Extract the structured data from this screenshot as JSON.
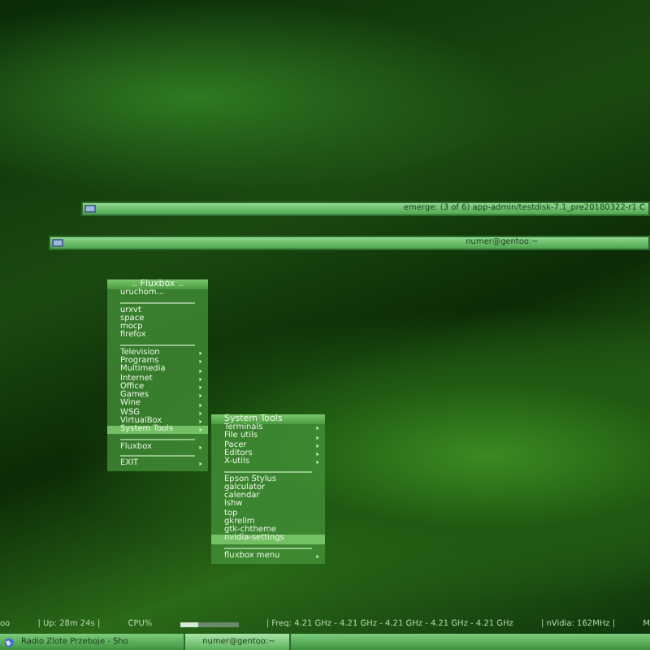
{
  "windows": [
    {
      "title": "emerge: (3 of 6) app-admin/testdisk-7.1_pre20180322-r1 C"
    },
    {
      "title": "numer@gentoo:~"
    }
  ],
  "root_menu": {
    "title": ".. Fluxbox ..",
    "items": [
      {
        "kind": "item",
        "label": "uruchom...",
        "selected": false
      },
      {
        "kind": "separator"
      },
      {
        "kind": "item",
        "label": "urxvt",
        "selected": false
      },
      {
        "kind": "item",
        "label": "space",
        "selected": false
      },
      {
        "kind": "item",
        "label": "mocp",
        "selected": false
      },
      {
        "kind": "item",
        "label": "firefox",
        "selected": false
      },
      {
        "kind": "separator"
      },
      {
        "kind": "submenu",
        "label": "Television",
        "selected": false
      },
      {
        "kind": "submenu",
        "label": "Programs",
        "selected": false
      },
      {
        "kind": "submenu",
        "label": "Multimedia",
        "selected": false
      },
      {
        "kind": "submenu",
        "label": "Internet",
        "selected": false
      },
      {
        "kind": "submenu",
        "label": "Office",
        "selected": false
      },
      {
        "kind": "submenu",
        "label": "Games",
        "selected": false
      },
      {
        "kind": "submenu",
        "label": "Wine",
        "selected": false
      },
      {
        "kind": "submenu",
        "label": "WSG",
        "selected": false
      },
      {
        "kind": "submenu",
        "label": "VirtualBox",
        "selected": false
      },
      {
        "kind": "submenu",
        "label": "System Tools",
        "selected": true
      },
      {
        "kind": "separator"
      },
      {
        "kind": "submenu",
        "label": "Fluxbox",
        "selected": false
      },
      {
        "kind": "separator"
      },
      {
        "kind": "submenu",
        "label": "EXIT",
        "selected": false
      }
    ]
  },
  "sub_menu": {
    "title": "System Tools",
    "items": [
      {
        "kind": "submenu",
        "label": "Terminals",
        "selected": false
      },
      {
        "kind": "submenu",
        "label": "File utils",
        "selected": false
      },
      {
        "kind": "submenu",
        "label": "Pacer",
        "selected": false
      },
      {
        "kind": "submenu",
        "label": "Editors",
        "selected": false
      },
      {
        "kind": "submenu",
        "label": "X-utils",
        "selected": false
      },
      {
        "kind": "separator"
      },
      {
        "kind": "item",
        "label": "Epson Stylus",
        "selected": false
      },
      {
        "kind": "item",
        "label": "galculator",
        "selected": false
      },
      {
        "kind": "item",
        "label": "calendar",
        "selected": false
      },
      {
        "kind": "item",
        "label": "lshw",
        "selected": false
      },
      {
        "kind": "item",
        "label": "top",
        "selected": false
      },
      {
        "kind": "item",
        "label": "gkrellm",
        "selected": false
      },
      {
        "kind": "item",
        "label": "gtk-chtheme",
        "selected": false
      },
      {
        "kind": "item",
        "label": "nvidia-settings",
        "selected": true
      },
      {
        "kind": "separator"
      },
      {
        "kind": "submenu",
        "label": "fluxbox menu",
        "selected": false
      }
    ]
  },
  "conky": {
    "lead": "oo",
    "uptime": "| Up: 28m 24s |",
    "cpu_label": "CPU%",
    "cpu": {
      "level": 0.3
    },
    "freq": "| Freq: 4.21 GHz - 4.21 GHz - 4.21 GHz - 4.21 GHz - 4.21 GHz",
    "gpu": "| nVidia: 162MHz |",
    "tail": "M"
  },
  "taskbar": {
    "tasks": [
      {
        "label": "Radio Zlote Przeboje - Sho",
        "selected": false
      },
      {
        "label": "numer@gentoo:~",
        "selected": true
      }
    ]
  }
}
